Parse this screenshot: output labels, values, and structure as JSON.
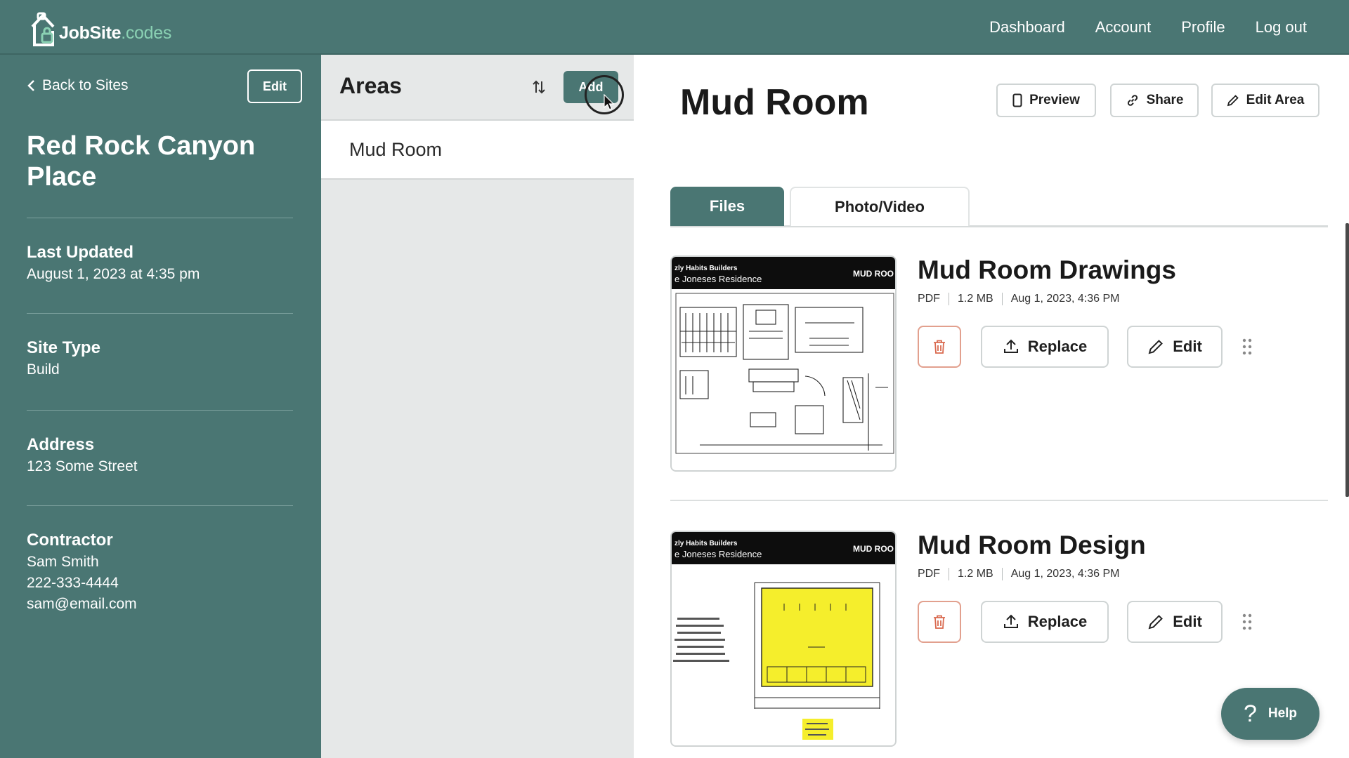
{
  "brand": {
    "name_bold": "JobSite",
    "name_light": ".codes"
  },
  "topnav": [
    {
      "label": "Dashboard"
    },
    {
      "label": "Account"
    },
    {
      "label": "Profile"
    },
    {
      "label": "Log out"
    }
  ],
  "sidebar": {
    "back_label": "Back to Sites",
    "edit_label": "Edit",
    "site_title": "Red Rock Canyon Place",
    "last_updated": {
      "label": "Last Updated",
      "value": "August 1, 2023 at 4:35 pm"
    },
    "site_type": {
      "label": "Site Type",
      "value": "Build"
    },
    "address": {
      "label": "Address",
      "value": "123 Some Street"
    },
    "contractor": {
      "label": "Contractor",
      "name": "Sam Smith",
      "phone": "222-333-4444",
      "email": "sam@email.com"
    }
  },
  "areas": {
    "title": "Areas",
    "add_label": "Add",
    "items": [
      {
        "label": "Mud Room"
      }
    ]
  },
  "main": {
    "title": "Mud Room",
    "preview_label": "Preview",
    "share_label": "Share",
    "edit_area_label": "Edit Area",
    "tabs": [
      {
        "label": "Files",
        "active": true
      },
      {
        "label": "Photo/Video",
        "active": false
      }
    ],
    "files": [
      {
        "title": "Mud Room Drawings",
        "type": "PDF",
        "size": "1.2 MB",
        "date": "Aug 1, 2023, 4:36 PM",
        "thumb_company": "zly Habits Builders",
        "thumb_project": "e Joneses Residence",
        "thumb_tag": "MUD ROO"
      },
      {
        "title": "Mud Room Design",
        "type": "PDF",
        "size": "1.2 MB",
        "date": "Aug 1, 2023, 4:36 PM",
        "thumb_company": "zly Habits Builders",
        "thumb_project": "e Joneses Residence",
        "thumb_tag": "MUD ROO"
      }
    ],
    "replace_label": "Replace",
    "edit_label": "Edit"
  },
  "help": {
    "label": "Help"
  },
  "colors": {
    "brand": "#4a7673",
    "accent_light": "#8ad1b3",
    "delete": "#d9694f",
    "panel": "#e6e8e8"
  }
}
